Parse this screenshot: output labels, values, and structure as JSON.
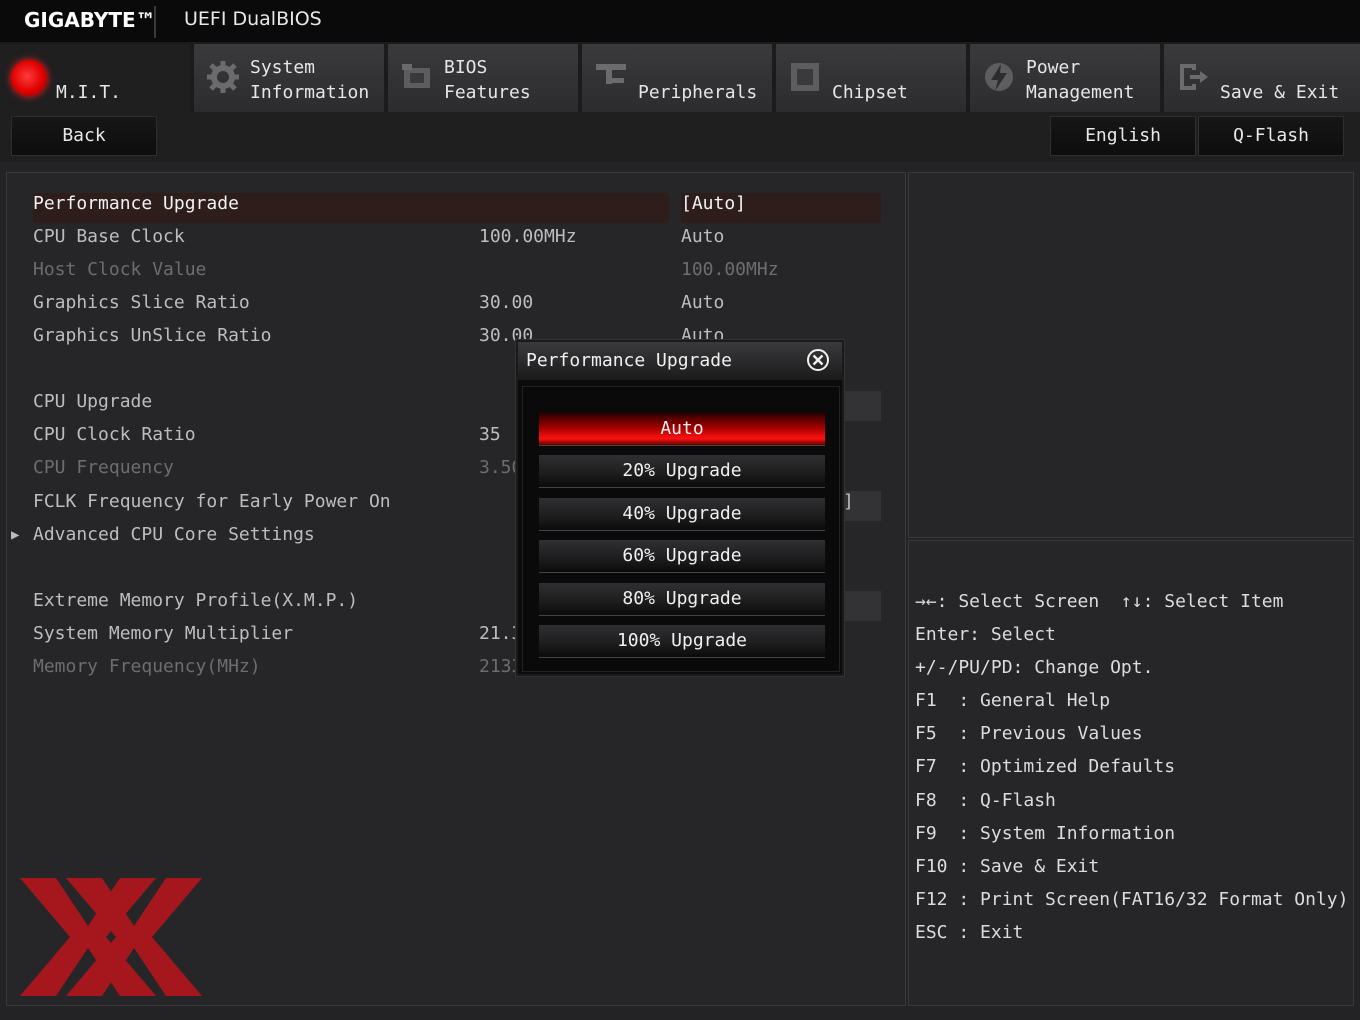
{
  "header": {
    "brand": "GIGABYTE™",
    "title": "UEFI DualBIOS"
  },
  "tabs": [
    {
      "label": "M.I.T.",
      "icon": "mit-red-dot-icon",
      "active": true
    },
    {
      "label": "System\nInformation",
      "icon": "gear-icon"
    },
    {
      "label": "BIOS\nFeatures",
      "icon": "bios-chip-icon"
    },
    {
      "label": "Peripherals",
      "icon": "peripherals-icon"
    },
    {
      "label": "Chipset",
      "icon": "chipset-icon"
    },
    {
      "label": "Power\nManagement",
      "icon": "power-icon"
    },
    {
      "label": "Save & Exit",
      "icon": "exit-icon"
    }
  ],
  "toolbar": {
    "back": "Back",
    "language": "English",
    "qflash": "Q-Flash"
  },
  "settings": [
    {
      "name": "Performance Upgrade",
      "value": "",
      "option": "[Auto]",
      "state": "selected"
    },
    {
      "name": "CPU Base Clock",
      "value": "100.00MHz",
      "option": "Auto",
      "state": "normal"
    },
    {
      "name": "Host Clock Value",
      "value": "",
      "option": "100.00MHz",
      "state": "dim"
    },
    {
      "name": "Graphics Slice Ratio",
      "value": "30.00",
      "option": "Auto",
      "state": "normal"
    },
    {
      "name": "Graphics UnSlice Ratio",
      "value": "30.00",
      "option": "Auto",
      "state": "normal"
    },
    {
      "name": "CPU Upgrade",
      "value": "",
      "option": "",
      "state": "normal"
    },
    {
      "name": "CPU Clock Ratio",
      "value": "35",
      "option": "",
      "state": "normal"
    },
    {
      "name": "CPU Frequency",
      "value": "3.50",
      "option": "",
      "state": "dim"
    },
    {
      "name": "FCLK Frequency for Early Power On",
      "value": "",
      "option": "]",
      "state": "normal"
    },
    {
      "name": "Advanced CPU Core Settings",
      "value": "",
      "option": "",
      "state": "normal"
    },
    {
      "name": "Extreme Memory Profile(X.M.P.)",
      "value": "",
      "option": "",
      "state": "normal"
    },
    {
      "name": "System Memory Multiplier",
      "value": "21.3",
      "option": "",
      "state": "normal"
    },
    {
      "name": "Memory Frequency(MHz)",
      "value": "2133",
      "option": "",
      "state": "dim"
    }
  ],
  "popup": {
    "title": "Performance Upgrade",
    "options": [
      "Auto",
      "20% Upgrade",
      "40% Upgrade",
      "60% Upgrade",
      "80% Upgrade",
      "100% Upgrade"
    ],
    "selected": "Auto"
  },
  "help": [
    "→←: Select Screen  ↑↓: Select Item",
    "Enter: Select",
    "+/-/PU/PD: Change Opt.",
    "F1  : General Help",
    "F5  : Previous Values",
    "F7  : Optimized Defaults",
    "F8  : Q-Flash",
    "F9  : System Information",
    "F10 : Save & Exit",
    "F12 : Print Screen(FAT16/32 Format Only)",
    "ESC : Exit"
  ],
  "colors": {
    "accent": "#e00000",
    "background": "#232325",
    "logo": "#b0161c"
  }
}
